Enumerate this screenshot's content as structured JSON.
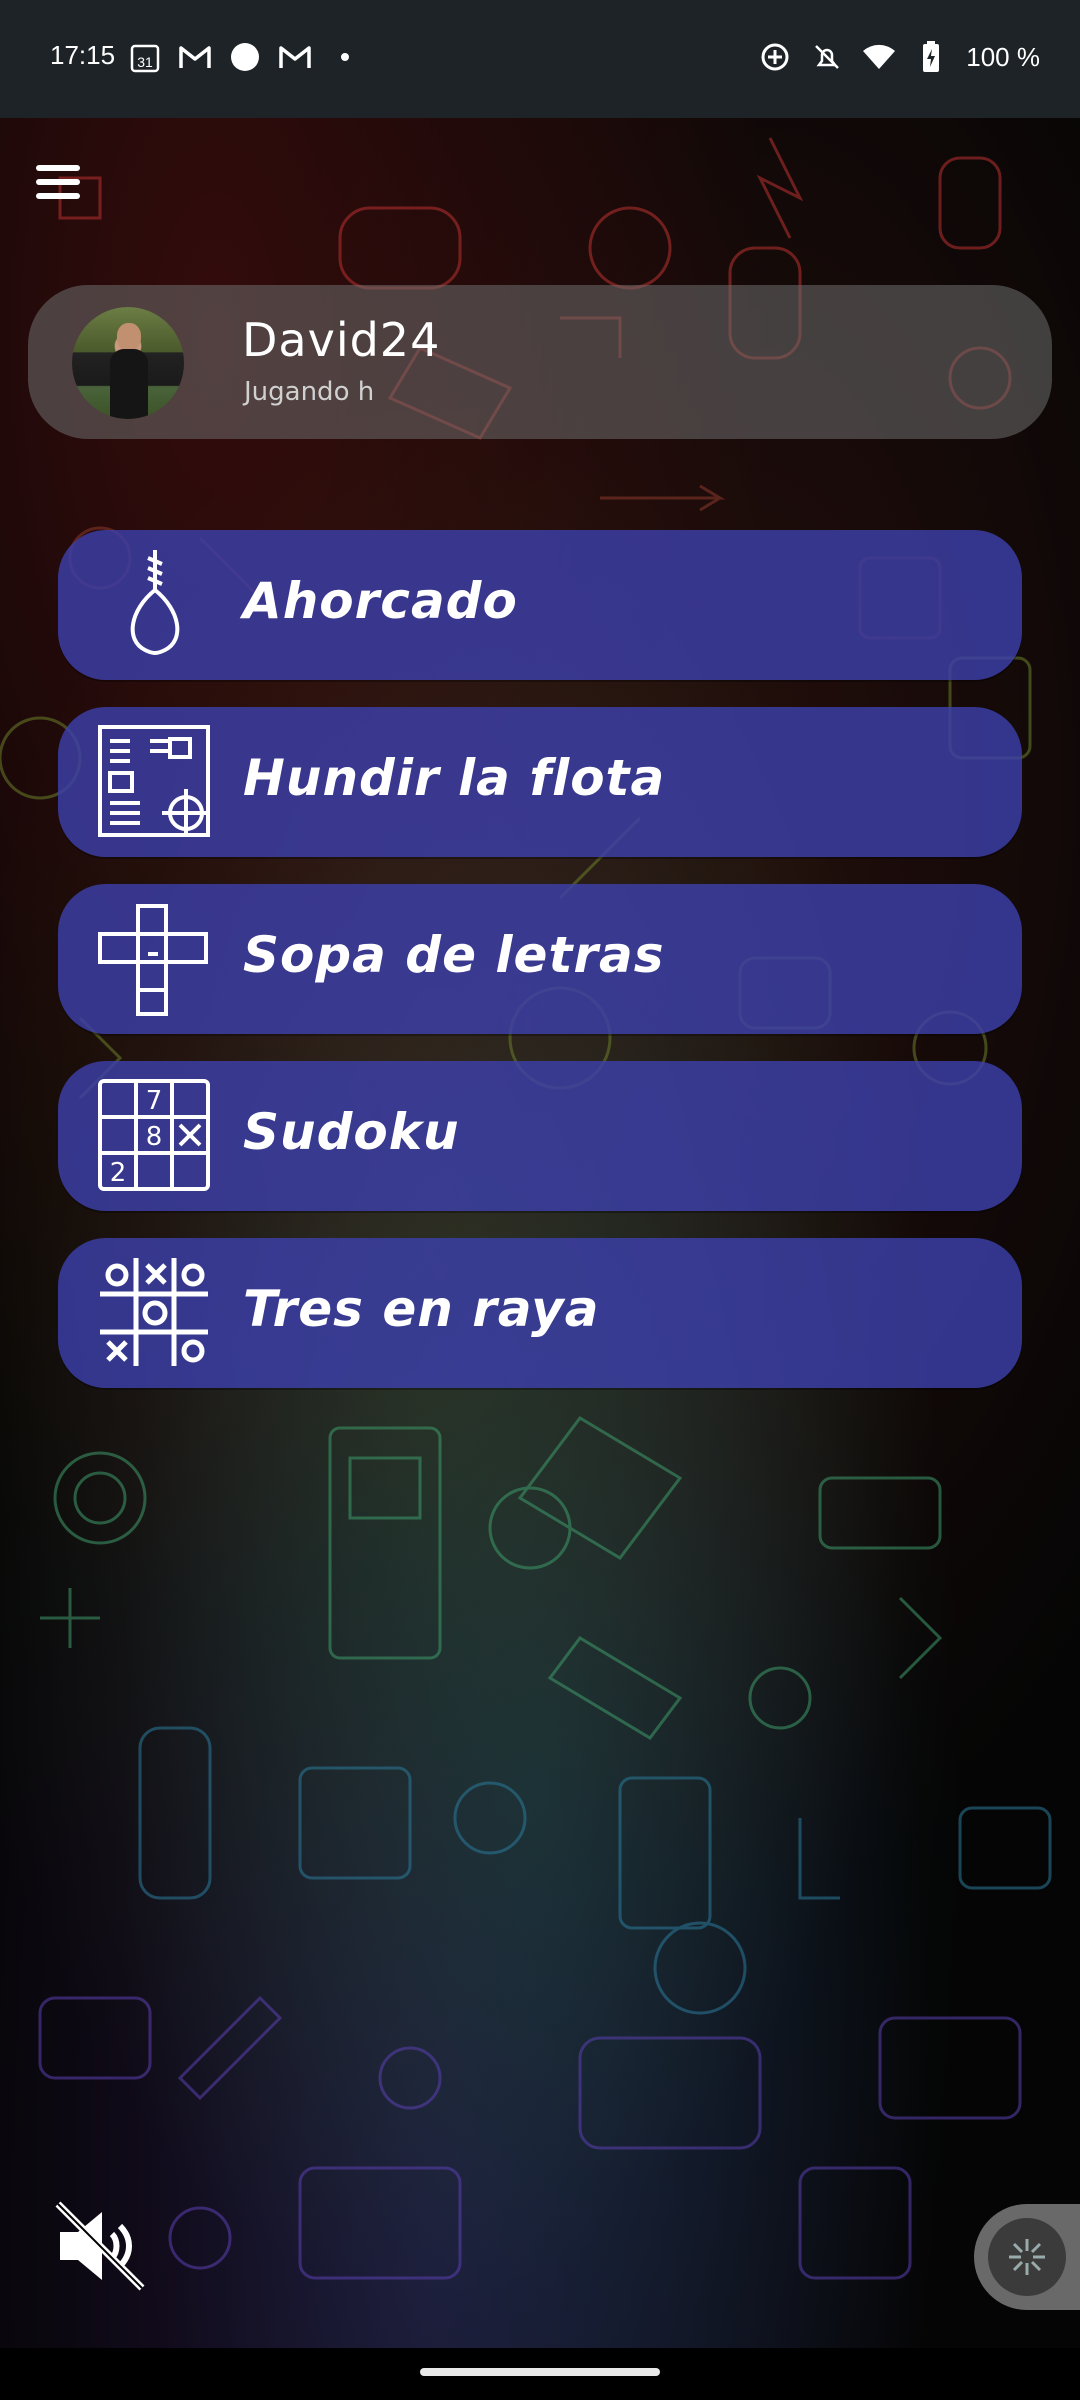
{
  "status_bar": {
    "time": "17:15",
    "calendar_day": "31",
    "battery": "100 %",
    "left_icons": [
      "calendar-icon",
      "gmail-icon",
      "circle-icon",
      "gmail-icon",
      "dot-icon"
    ],
    "right_icons": [
      "data-saver-icon",
      "mute-notifications-icon",
      "wifi-icon",
      "battery-icon"
    ]
  },
  "profile": {
    "name": "David24",
    "status": "Jugando h"
  },
  "games": [
    {
      "label": "Ahorcado",
      "icon": "hangman-noose-icon"
    },
    {
      "label": "Hundir la flota",
      "icon": "battleship-board-icon"
    },
    {
      "label": "Sopa de letras",
      "icon": "crossword-icon"
    },
    {
      "label": "Sudoku",
      "icon": "sudoku-grid-icon"
    },
    {
      "label": "Tres en raya",
      "icon": "tic-tac-toe-icon"
    }
  ],
  "sudoku_icon_digits": [
    "7",
    "8",
    "2"
  ],
  "controls": {
    "mute": "volume-off-icon",
    "fab": "sparkle-icon"
  },
  "colors": {
    "button_bg": "#3c40aa",
    "profile_bg": "#6e6e6e",
    "status_bar_bg": "#1d2326"
  }
}
